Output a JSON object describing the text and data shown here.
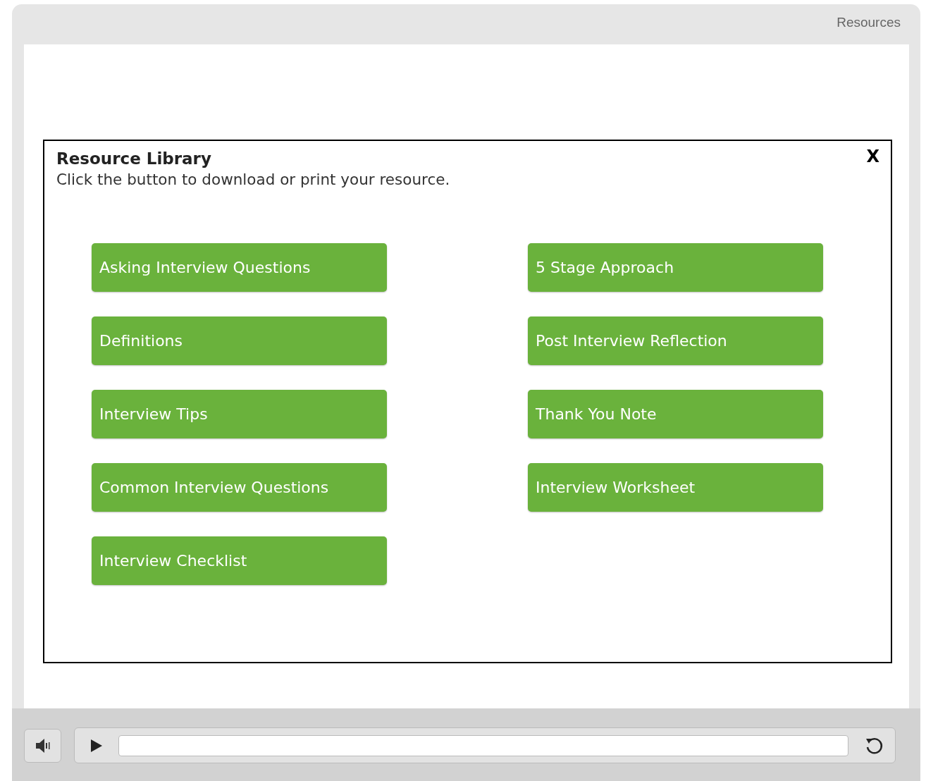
{
  "top_bar": {
    "resources_link": "Resources"
  },
  "dialog": {
    "title": "Resource Library",
    "instruction": "Click the button to download or print your resource.",
    "close": "X",
    "columns": [
      [
        "Asking Interview Questions",
        "Definitions",
        "Interview Tips",
        "Common Interview Questions",
        "Interview Checklist"
      ],
      [
        "5 Stage Approach",
        "Post Interview Reflection",
        "Thank You Note",
        "Interview Worksheet"
      ]
    ]
  }
}
